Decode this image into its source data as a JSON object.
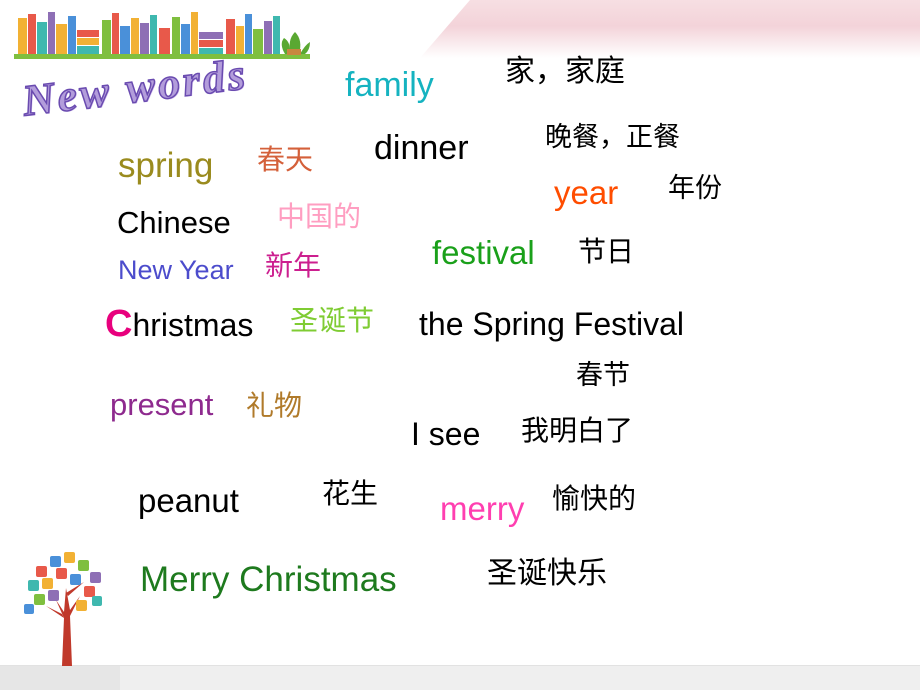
{
  "slide": {
    "title": "New words",
    "background_color": "#ffffff",
    "ribbon_color": "#f3d3d9",
    "bottom_band_color": "#efefef"
  },
  "decorations": {
    "bookshelf": "bookshelf-icon",
    "tree": "knowledge-tree-icon",
    "ribbon": "pink-ribbon-shape"
  },
  "vocabulary": [
    {
      "en": "family",
      "cn": "家，家庭",
      "en_color": "#15b3c0",
      "cn_color": "#000000"
    },
    {
      "en": "dinner",
      "cn": "晚餐，正餐",
      "en_color": "#000000",
      "cn_color": "#000000"
    },
    {
      "en": "spring",
      "cn": "春天",
      "en_color": "#9a8b1e",
      "cn_color": "#d4603a"
    },
    {
      "en": "year",
      "cn": "年份",
      "en_color": "#ff4d00",
      "cn_color": "#000000"
    },
    {
      "en": "Chinese",
      "cn": "中国的",
      "en_color": "#000000",
      "cn_color": "#ff9ec1"
    },
    {
      "en": "festival",
      "cn": "节日",
      "en_color": "#1aa01a",
      "cn_color": "#000000"
    },
    {
      "en": "New Year",
      "cn": "新年",
      "en_color": "#4c4ccc",
      "cn_color": "#cc1f8f"
    },
    {
      "en": "Christmas",
      "cn": "圣诞节",
      "en_color": "#000000",
      "cn_color": "#7fcc33"
    },
    {
      "en": "the Spring Festival",
      "cn": "春节",
      "en_color": "#000000",
      "cn_color": "#000000"
    },
    {
      "en": "present",
      "cn": "礼物",
      "en_color": "#8e2a8e",
      "cn_color": "#b07a2a"
    },
    {
      "en": "I see",
      "cn": "我明白了",
      "en_color": "#000000",
      "cn_color": "#000000"
    },
    {
      "en": "peanut",
      "cn": "花生",
      "en_color": "#000000",
      "cn_color": "#000000"
    },
    {
      "en": "merry",
      "cn": "愉快的",
      "en_color": "#ff3fb0",
      "cn_color": "#000000"
    },
    {
      "en": "Merry Christmas",
      "cn": "圣诞快乐",
      "en_color": "#1e7a1e",
      "cn_color": "#000000"
    }
  ],
  "christmas_parts": {
    "cap": "C",
    "rest": "hristmas"
  }
}
